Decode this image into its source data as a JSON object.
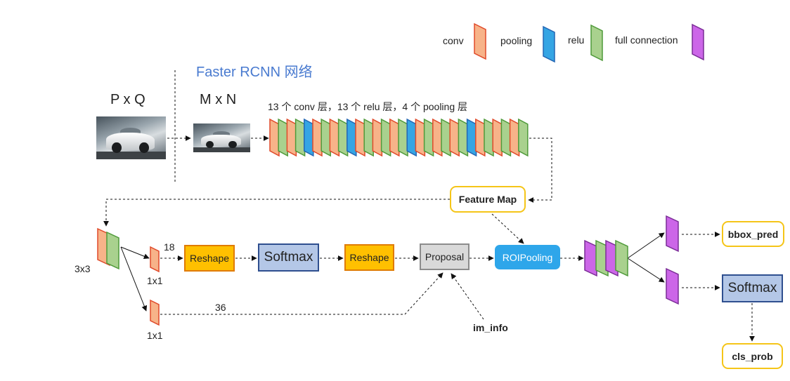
{
  "title": "Faster RCNN 网络",
  "legend": [
    {
      "label": "conv",
      "color": "#f7b389"
    },
    {
      "label": "pooling",
      "color": "#35a5e4"
    },
    {
      "label": "relu",
      "color": "#a9d18e"
    },
    {
      "label": "full connection",
      "color": "#cc66e8"
    }
  ],
  "input": {
    "size_label": "P x Q",
    "image_icon": "car-photo"
  },
  "resized": {
    "size_label": "M x N",
    "image_icon": "car-photo"
  },
  "backbone": {
    "caption": "13 个 conv 层，13 个 relu 层，4 个 pooling 层",
    "layers": [
      "conv",
      "relu",
      "conv",
      "relu",
      "pooling",
      "conv",
      "relu",
      "conv",
      "relu",
      "pooling",
      "conv",
      "relu",
      "conv",
      "relu",
      "conv",
      "relu",
      "pooling",
      "conv",
      "relu",
      "conv",
      "relu",
      "conv",
      "relu",
      "pooling",
      "conv",
      "relu",
      "conv",
      "relu",
      "conv",
      "relu"
    ]
  },
  "feature_map": "Feature Map",
  "rpn": {
    "conv3_label": "3x3",
    "cls_conv_label": "1x1",
    "reg_conv_label": "1x1",
    "cls_channels": "18",
    "reg_channels": "36",
    "reshape1": "Reshape",
    "softmax": "Softmax",
    "reshape2": "Reshape",
    "proposal": "Proposal",
    "im_info": "im_info"
  },
  "head": {
    "roi_pooling": "ROIPooling",
    "bbox_pred": "bbox_pred",
    "softmax": "Softmax",
    "cls_prob": "cls_prob"
  },
  "colors": {
    "conv": "#f7b389",
    "conv_stroke": "#e04a2a",
    "pooling": "#35a5e4",
    "pooling_stroke": "#2466b4",
    "relu": "#a9d18e",
    "relu_stroke": "#4f9a3a",
    "fc": "#cc66e8",
    "fc_stroke": "#7a2d96",
    "title": "#4a7bd0",
    "yellow_border": "#f5c518",
    "reshape_fill": "#ffc000",
    "reshape_stroke": "#e07b00",
    "softmax_fill": "#b4c7e7",
    "softmax_stroke": "#2f4f8f",
    "proposal_fill": "#d9d9d9",
    "proposal_stroke": "#8c8c8c",
    "roi_fill": "#2ea6ea"
  }
}
